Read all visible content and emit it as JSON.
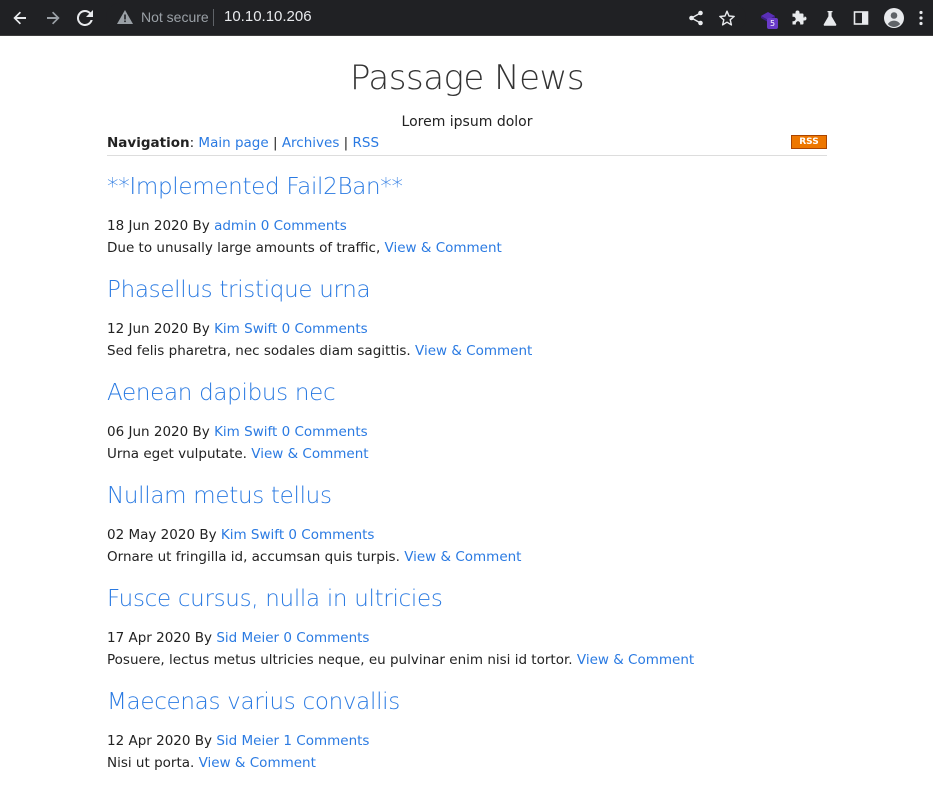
{
  "browser": {
    "security_label": "Not secure",
    "url": "10.10.10.206",
    "extension_badge": "5"
  },
  "site": {
    "title": "Passage News",
    "subtitle": "Lorem ipsum dolor"
  },
  "nav": {
    "label": "Navigation",
    "links": [
      "Main page",
      "Archives",
      "RSS"
    ],
    "rss_badge": "RSS"
  },
  "posts": [
    {
      "title": "**Implemented Fail2Ban**",
      "date": "18 Jun 2020",
      "by": "By",
      "author": "admin",
      "comments": "0 Comments",
      "excerpt": "Due to unusally large amounts of traffic,",
      "link": "View & Comment"
    },
    {
      "title": "Phasellus tristique urna",
      "date": "12 Jun 2020",
      "by": "By",
      "author": "Kim Swift",
      "comments": "0 Comments",
      "excerpt": "Sed felis pharetra, nec sodales diam sagittis.",
      "link": "View & Comment"
    },
    {
      "title": "Aenean dapibus nec",
      "date": "06 Jun 2020",
      "by": "By",
      "author": "Kim Swift",
      "comments": "0 Comments",
      "excerpt": "Urna eget vulputate.",
      "link": "View & Comment"
    },
    {
      "title": "Nullam metus tellus",
      "date": "02 May 2020",
      "by": "By",
      "author": "Kim Swift",
      "comments": "0 Comments",
      "excerpt": "Ornare ut fringilla id, accumsan quis turpis.",
      "link": "View & Comment"
    },
    {
      "title": "Fusce cursus, nulla in ultricies",
      "date": "17 Apr 2020",
      "by": "By",
      "author": "Sid Meier",
      "comments": "0 Comments",
      "excerpt": "Posuere, lectus metus ultricies neque, eu pulvinar enim nisi id tortor.",
      "link": "View & Comment"
    },
    {
      "title": "Maecenas varius convallis",
      "date": "12 Apr 2020",
      "by": "By",
      "author": "Sid Meier",
      "comments": "1 Comments",
      "excerpt": "Nisi ut porta.",
      "link": "View & Comment"
    }
  ],
  "colors": {
    "link": "#2a7ae2",
    "toolbar": "#202124",
    "rss": "#ee7700"
  }
}
